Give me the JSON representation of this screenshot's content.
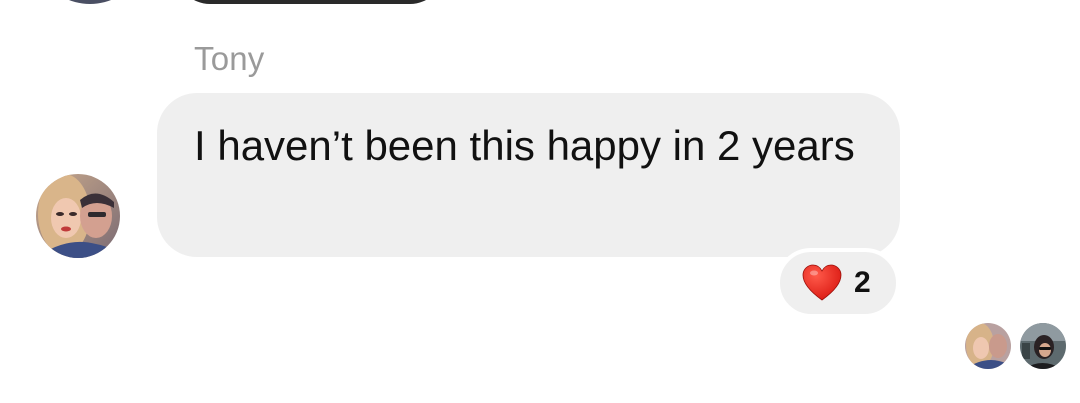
{
  "message": {
    "sender_name": "Tony",
    "text": "I haven’t been this happy in 2 years"
  },
  "reaction": {
    "emoji": "heart-icon",
    "count": "2",
    "color": "#e8221b"
  },
  "seen_by": [
    "avatar-1",
    "avatar-2"
  ],
  "colors": {
    "bubble_bg": "#efefef",
    "sender_name": "#9a9a9a",
    "text": "#111111"
  }
}
